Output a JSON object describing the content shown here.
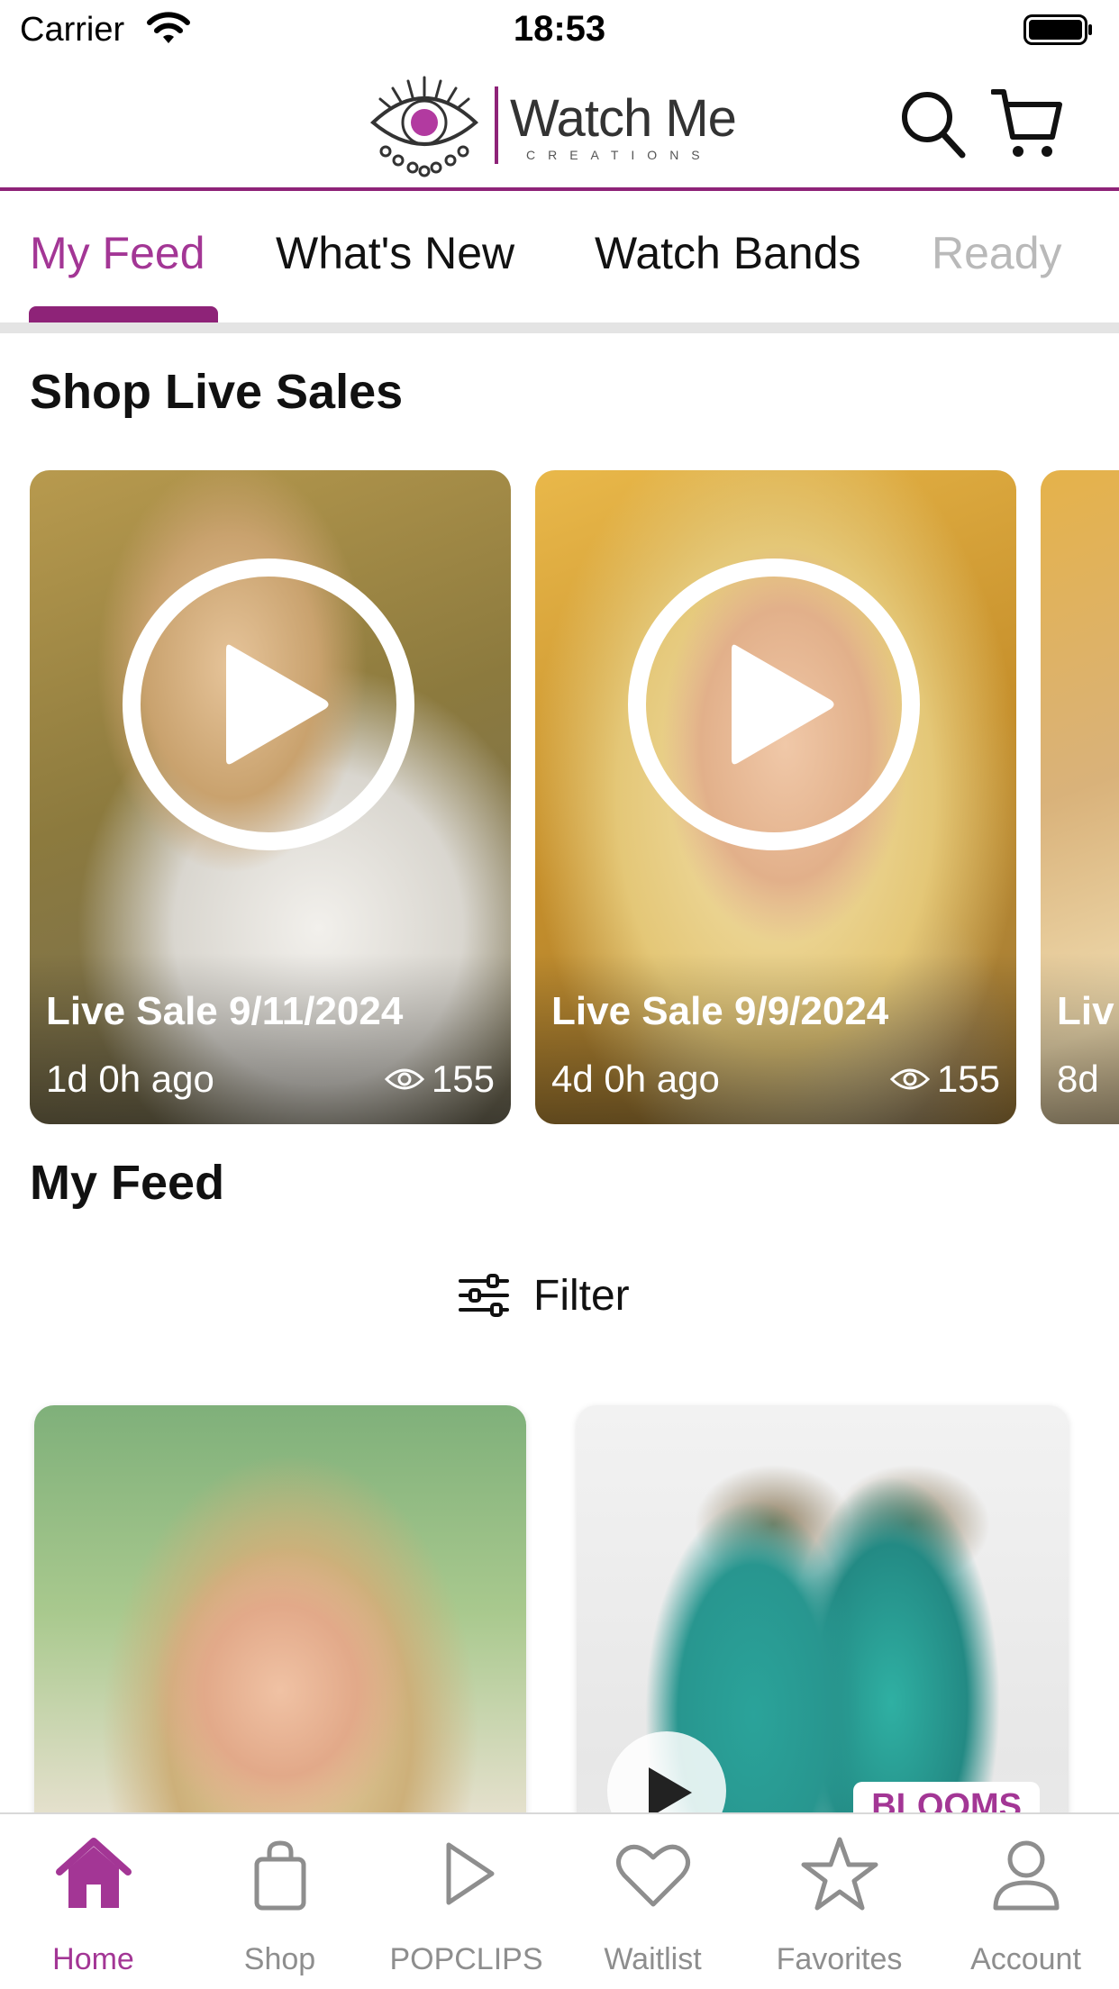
{
  "status_bar": {
    "carrier": "Carrier",
    "time": "18:53"
  },
  "header": {
    "brand": "Watch Me",
    "brand_sub": "CREATIONS",
    "accent": "#8e2378",
    "icons": [
      "eye-logo-icon",
      "search-icon",
      "cart-icon"
    ]
  },
  "tabs": [
    {
      "label": "My Feed",
      "active": true
    },
    {
      "label": "What's New"
    },
    {
      "label": "Watch Bands"
    },
    {
      "label": "Ready"
    }
  ],
  "live_section": {
    "title": "Shop Live Sales",
    "cards": [
      {
        "title": "Live Sale 9/11/2024",
        "ago": "1d 0h ago",
        "views": "155"
      },
      {
        "title": "Live Sale 9/9/2024",
        "ago": "4d 0h ago",
        "views": "155"
      },
      {
        "title": "Liv",
        "ago": "8d",
        "views": ""
      }
    ]
  },
  "feed_section": {
    "title": "My Feed",
    "filter_label": "Filter",
    "cards": [
      {
        "badge": ""
      },
      {
        "badge": "BLOOMS"
      }
    ]
  },
  "bottom_nav": [
    {
      "label": "Home",
      "icon": "home-icon",
      "active": true
    },
    {
      "label": "Shop",
      "icon": "shopping-bag-icon"
    },
    {
      "label": "POPCLIPS",
      "icon": "play-icon"
    },
    {
      "label": "Waitlist",
      "icon": "heart-icon"
    },
    {
      "label": "Favorites",
      "icon": "star-icon"
    },
    {
      "label": "Account",
      "icon": "person-icon"
    }
  ]
}
